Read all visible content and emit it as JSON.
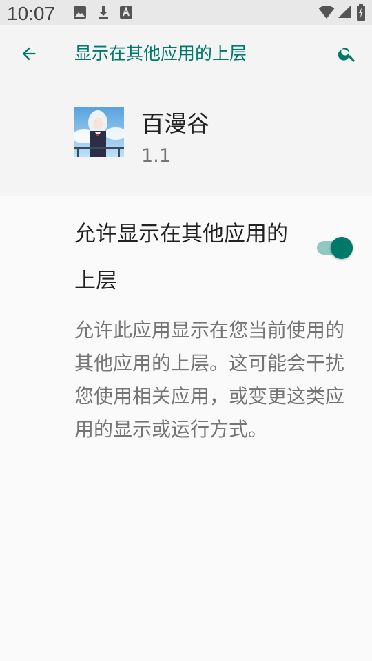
{
  "status_bar": {
    "time": "10:07",
    "icons": [
      "image-icon",
      "download-icon",
      "font-icon",
      "wifi-icon",
      "signal-icon",
      "battery-charging-icon"
    ]
  },
  "toolbar": {
    "title": "显示在其他应用的上层",
    "back_icon": "arrow-back-icon",
    "search_icon": "search-icon",
    "accent_color": "#00796b"
  },
  "app": {
    "name": "百漫谷",
    "version": "1.1"
  },
  "setting": {
    "label": "允许显示在其他应用的上层",
    "enabled": true,
    "description": "允许此应用显示在您当前使用的其他应用的上层。这可能会干扰您使用相关应用，或变更这类应用的显示或运行方式。"
  }
}
